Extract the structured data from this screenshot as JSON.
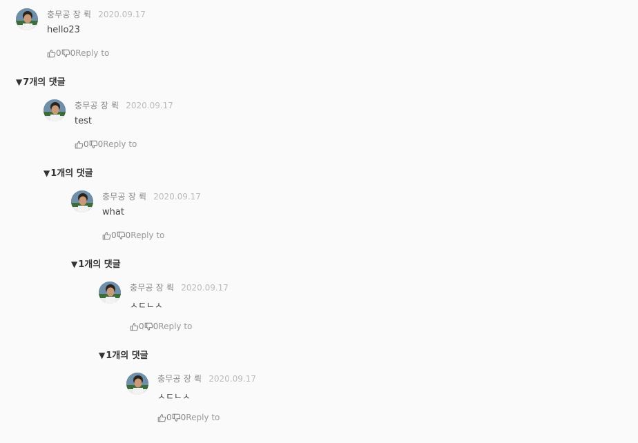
{
  "comments": [
    {
      "author": "충무공 장 뤽",
      "date": "2020.09.17",
      "text": "hello23",
      "likes": "0",
      "dislikes": "0",
      "reply": "Reply to"
    },
    {
      "author": "충무공 장 뤽",
      "date": "2020.09.17",
      "text": "test",
      "likes": "0",
      "dislikes": "0",
      "reply": "Reply to"
    },
    {
      "author": "충무공 장 뤽",
      "date": "2020.09.17",
      "text": "what",
      "likes": "0",
      "dislikes": "0",
      "reply": "Reply to"
    },
    {
      "author": "충무공 장 뤽",
      "date": "2020.09.17",
      "text": "ㅅㄷㄴㅅ",
      "likes": "0",
      "dislikes": "0",
      "reply": "Reply to"
    },
    {
      "author": "충무공 장 뤽",
      "date": "2020.09.17",
      "text": "ㅅㄷㄴㅅ",
      "likes": "0",
      "dislikes": "0",
      "reply": "Reply to"
    }
  ],
  "toggles": [
    {
      "arrow": "▼",
      "label": "7개의 댓글"
    },
    {
      "arrow": "▼",
      "label": "1개의 댓글"
    },
    {
      "arrow": "▼",
      "label": "1개의 댓글"
    },
    {
      "arrow": "▼",
      "label": "1개의 댓글"
    }
  ],
  "icons": {
    "like": "thumbs-up-icon",
    "dislike": "thumbs-down-icon",
    "avatar": "user-avatar"
  }
}
